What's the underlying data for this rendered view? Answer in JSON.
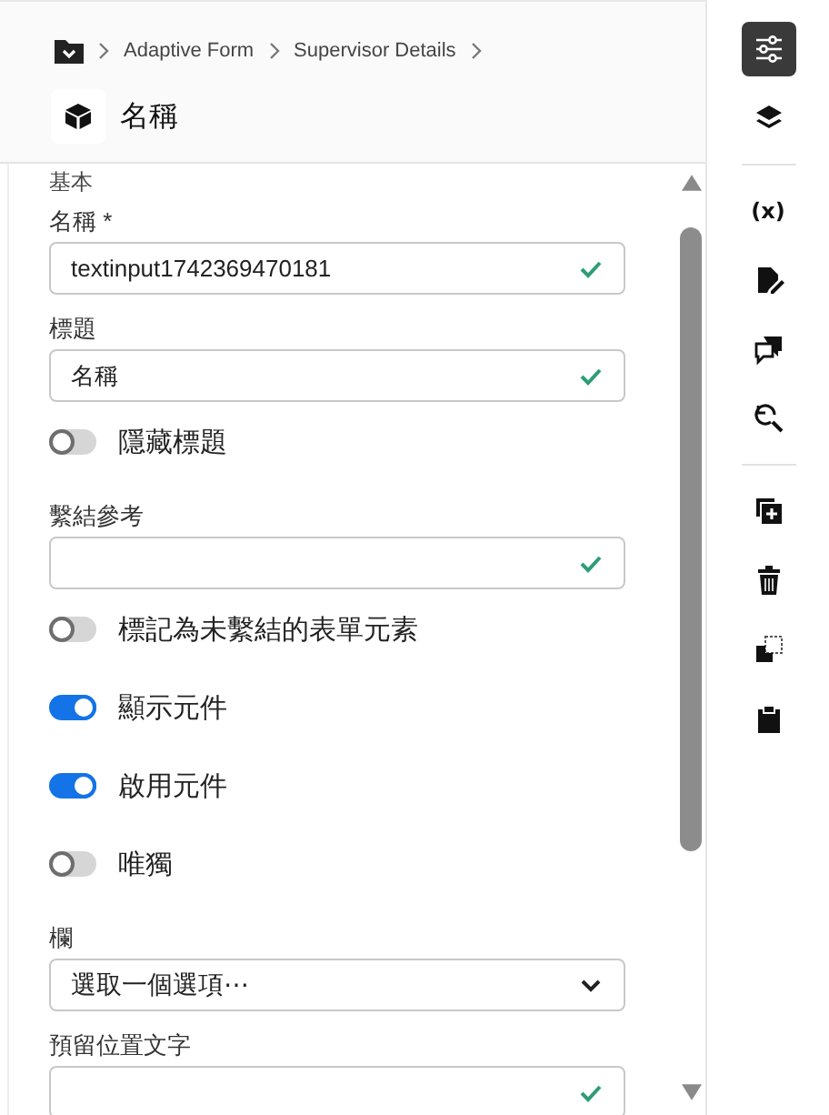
{
  "breadcrumb": [
    {
      "kind": "folder"
    },
    {
      "kind": "text",
      "label": "Adaptive Form"
    },
    {
      "kind": "text",
      "label": "Supervisor Details"
    }
  ],
  "header": {
    "title": "名稱"
  },
  "section": "基本",
  "fields": [
    {
      "kind": "text",
      "label": "名稱 *",
      "value": "textinput1742369470181",
      "valid": true
    },
    {
      "kind": "text",
      "label": "標題",
      "value": "名稱",
      "valid": true
    },
    {
      "kind": "toggle",
      "label": "隱藏標題",
      "on": false
    },
    {
      "kind": "text",
      "label": "繫結參考",
      "valid": true
    },
    {
      "kind": "toggle",
      "label": "標記為未繫結的表單元素",
      "on": false
    },
    {
      "kind": "toggle",
      "label": "顯示元件",
      "on": true
    },
    {
      "kind": "toggle",
      "label": "啟用元件",
      "on": true
    },
    {
      "kind": "toggle",
      "label": "唯獨",
      "on": false
    },
    {
      "kind": "select",
      "label": "欄",
      "value": "選取一個選項⋯"
    },
    {
      "kind": "text",
      "label": "預留位置文字",
      "valid": true
    }
  ],
  "toolbar": [
    {
      "kind": "sliders",
      "selected": true
    },
    {
      "kind": "layers",
      "selected": false
    },
    {
      "kind": "divider"
    },
    {
      "kind": "text",
      "label": "(x)",
      "selected": false
    },
    {
      "kind": "doc-edit",
      "selected": false
    },
    {
      "kind": "comments",
      "selected": false
    },
    {
      "kind": "search-refresh",
      "selected": false
    },
    {
      "kind": "divider"
    },
    {
      "kind": "duplicate",
      "selected": false
    },
    {
      "kind": "delete",
      "selected": false
    },
    {
      "kind": "copy",
      "selected": false
    },
    {
      "kind": "paste",
      "selected": false
    }
  ]
}
